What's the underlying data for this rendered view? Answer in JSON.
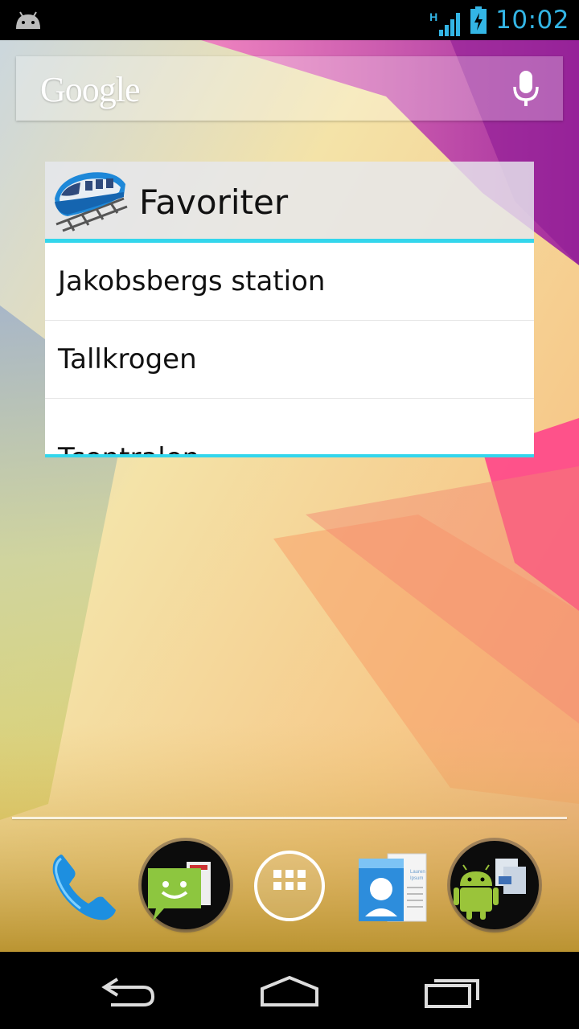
{
  "status_bar": {
    "network_type": "H",
    "time": "10:02",
    "icons": [
      "android-notification-icon",
      "signal-icon",
      "battery-charging-icon"
    ]
  },
  "search": {
    "logo_text": "Google",
    "icons": [
      "mic-icon"
    ]
  },
  "widget": {
    "title": "Favoriter",
    "icon": "train-icon",
    "items": [
      {
        "label": "Jakobsbergs station"
      },
      {
        "label": "Tallkrogen"
      },
      {
        "label": "Tcentralen"
      }
    ]
  },
  "dock": {
    "apps": [
      "phone-icon",
      "messaging-icon",
      "app-drawer-icon",
      "contacts-icon",
      "android-apps-icon"
    ]
  },
  "contacts_card": {
    "line1": "Lauren",
    "line2": "Ipsum"
  },
  "nav_bar": {
    "buttons": [
      "back-icon",
      "home-icon",
      "recent-apps-icon"
    ]
  },
  "colors": {
    "accent": "#33b5e5",
    "widget_divider": "#33d6ec"
  }
}
